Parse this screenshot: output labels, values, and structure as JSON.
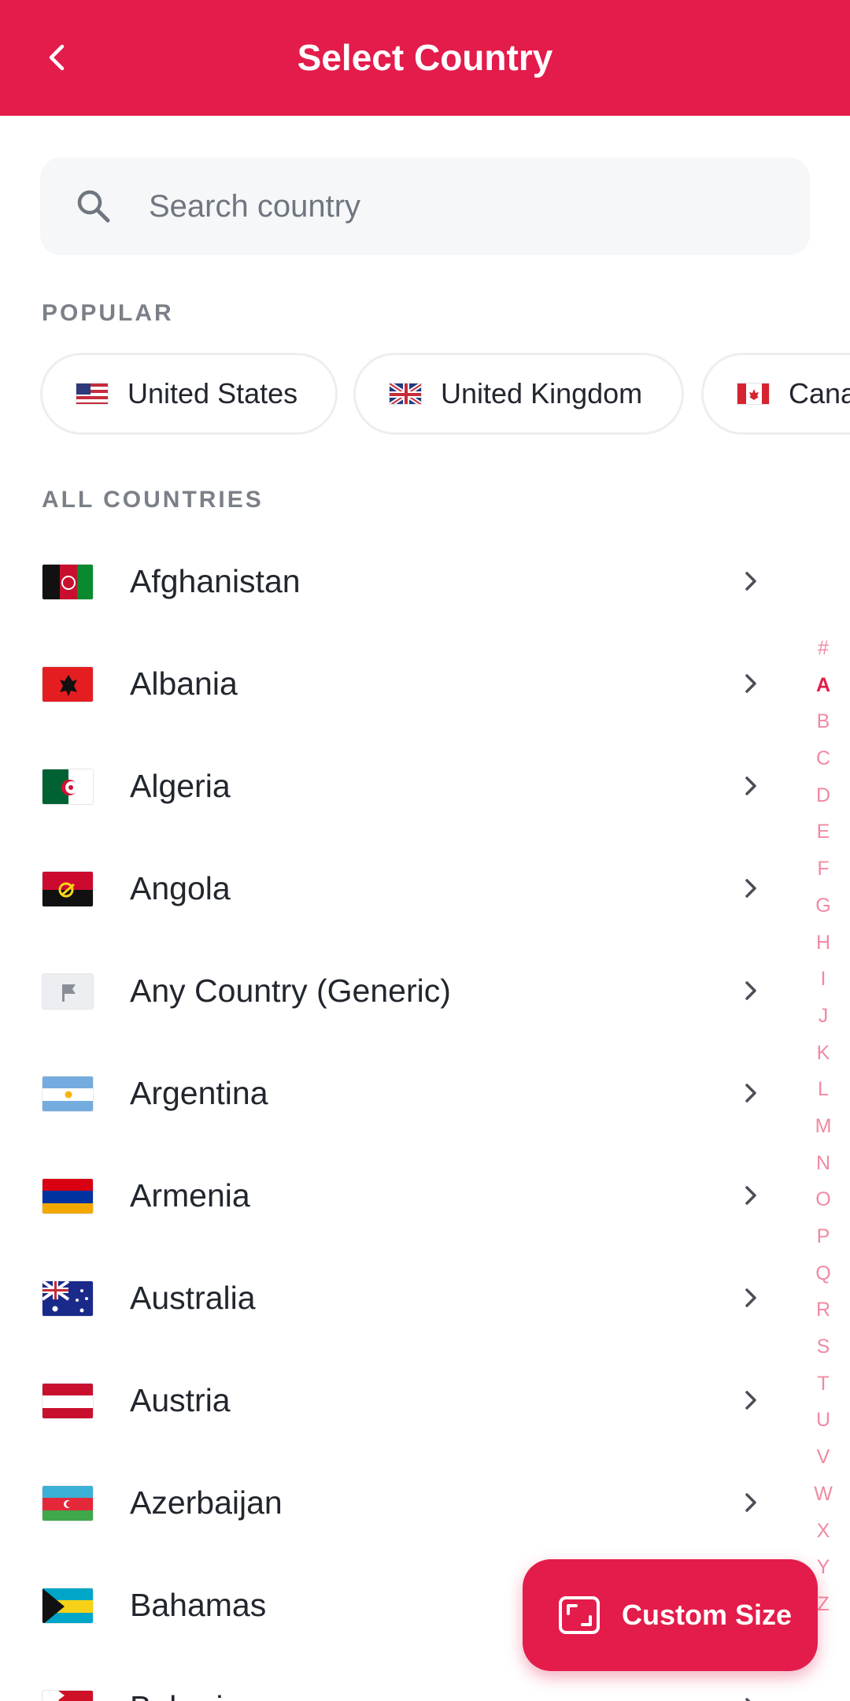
{
  "appbar": {
    "title": "Select Country",
    "back_icon": "chevron-left-icon"
  },
  "search": {
    "placeholder": "Search country",
    "value": "",
    "icon": "search-icon"
  },
  "popular": {
    "label": "POPULAR",
    "chips": [
      {
        "label": "United States",
        "flag": "us"
      },
      {
        "label": "United Kingdom",
        "flag": "gb"
      },
      {
        "label": "Canada",
        "flag": "ca"
      }
    ]
  },
  "all_countries": {
    "label": "ALL COUNTRIES",
    "items": [
      {
        "label": "Afghanistan",
        "flag": "af"
      },
      {
        "label": "Albania",
        "flag": "al"
      },
      {
        "label": "Algeria",
        "flag": "dz"
      },
      {
        "label": "Angola",
        "flag": "ao"
      },
      {
        "label": "Any Country (Generic)",
        "flag": "generic"
      },
      {
        "label": "Argentina",
        "flag": "ar"
      },
      {
        "label": "Armenia",
        "flag": "am"
      },
      {
        "label": "Australia",
        "flag": "au"
      },
      {
        "label": "Austria",
        "flag": "at"
      },
      {
        "label": "Azerbaijan",
        "flag": "az"
      },
      {
        "label": "Bahamas",
        "flag": "bs"
      },
      {
        "label": "Bahrain",
        "flag": "bh"
      }
    ]
  },
  "alphabet_index": {
    "letters": [
      "#",
      "A",
      "B",
      "C",
      "D",
      "E",
      "F",
      "G",
      "H",
      "I",
      "J",
      "K",
      "L",
      "M",
      "N",
      "O",
      "P",
      "Q",
      "R",
      "S",
      "T",
      "U",
      "V",
      "W",
      "X",
      "Y",
      "Z"
    ],
    "active": "A"
  },
  "fab": {
    "label": "Custom Size",
    "icon": "resize-frame-icon"
  },
  "colors": {
    "accent": "#e31c4b",
    "index_letter": "#f08aa2",
    "muted_label": "#7b8088",
    "text": "#22262e",
    "search_bg": "#f6f7f9"
  }
}
